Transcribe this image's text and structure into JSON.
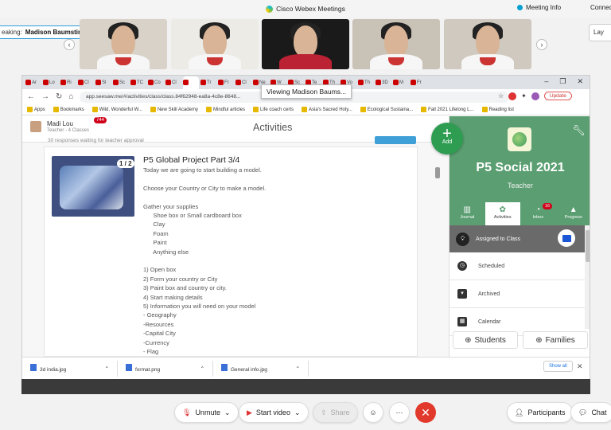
{
  "webex": {
    "title": "Cisco Webex Meetings",
    "meeting_info": "Meeting Info",
    "connect": "Connect",
    "layout": "Lay",
    "speaking_label": "eaking:",
    "speaking_name": "Madison Baumstimler (Coh...",
    "controls": {
      "unmute": "Unmute",
      "start_video": "Start video",
      "share": "Share",
      "participants": "Participants",
      "chat": "Chat"
    }
  },
  "browser": {
    "tabs": [
      "Ar",
      "Lo",
      "Ri",
      "Cl",
      "Sl",
      "Sc",
      "TC",
      "Co",
      "Cl",
      "",
      "Tr",
      "Fr",
      "Cl",
      "Ne",
      "W",
      "Sc",
      "Te",
      "Th",
      "Vo",
      "Th",
      "3D",
      "M",
      "Fr"
    ],
    "tooltip": "Viewing Madison Baums...",
    "url": "app.seesaw.me/#/activities/class/class.84f62948-ea8a-4c8e-8648...",
    "update": "Update",
    "bookmarks": [
      "Apps",
      "Bookmarks",
      "Wild, Wonderful W...",
      "New Skill Academy",
      "Mindful articles",
      "Life coach certs",
      "Asia's Sacred Holy...",
      "Ecological Sustaina...",
      "Fall 2021 Lifelong L...",
      "Reading list"
    ],
    "downloads": [
      "3d india.jpg",
      "format.png",
      "General info.jpg"
    ],
    "show_all": "Show all"
  },
  "seesaw": {
    "teacher_name": "Madi Lou",
    "teacher_sub": "Teacher - 4 Classes",
    "badge": "744",
    "heading": "Activities",
    "banner_text": "30 responses waiting for teacher approval",
    "post": {
      "counter": "1 / 2",
      "title": "P5 Global Project Part 3/4",
      "lines": [
        "Today we are going to start building a model.",
        "",
        "Choose your Country or City to make a model.",
        "",
        "Gather your supplies",
        "      Shoe box or Small cardboard box",
        "      Clay",
        "      Foam",
        "      Paint",
        "      Anything else",
        "",
        "1) Open box",
        "2) Form your country or City",
        "3) Paint box and country or city.",
        "4) Start making details",
        "5) Information you will need on your model",
        "- Geography",
        "-Resources",
        "-Capital City",
        "-Currency",
        "- Flag"
      ]
    },
    "add_label": "Add",
    "class_title": "P5 Social 2021",
    "class_role": "Teacher",
    "nav": [
      "Journal",
      "Activities",
      "Inbox",
      "Progress"
    ],
    "inbox_badge": "16",
    "assigned": "Assigned to Class",
    "rows": [
      "Scheduled",
      "Archived",
      "Calendar"
    ],
    "students": "Students",
    "families": "Families"
  }
}
